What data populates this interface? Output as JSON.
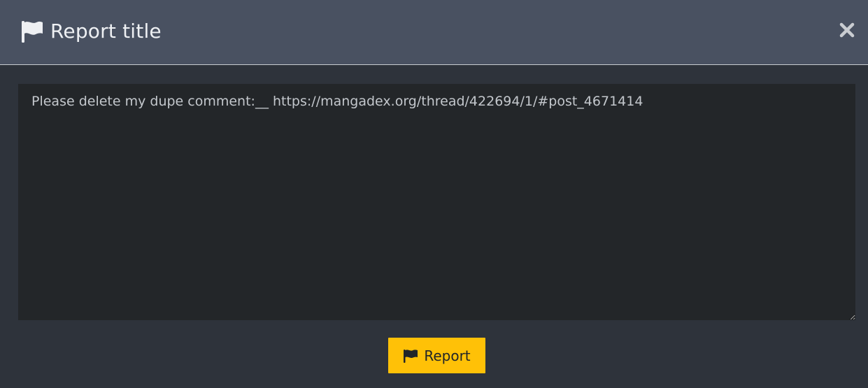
{
  "modal": {
    "title": "Report title",
    "header_icon": "flag-icon",
    "close_icon": "close-icon"
  },
  "form": {
    "textarea_value": "Please delete my dupe comment:__ https://mangadex.org/thread/422694/1/#post_4671414",
    "submit_label": "Report",
    "submit_icon": "flag-icon"
  },
  "colors": {
    "header_bg": "#495161",
    "body_bg": "#2e333b",
    "textarea_bg": "#232629",
    "button_bg": "#ffc107"
  }
}
